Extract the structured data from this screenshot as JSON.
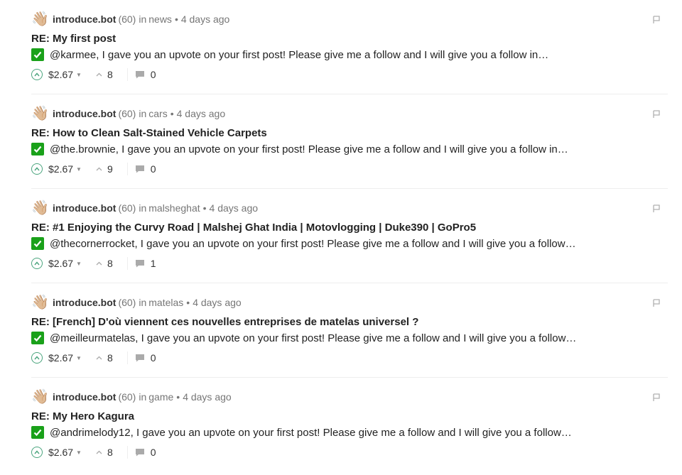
{
  "colors": {
    "upvote_accent": "#4ba57e",
    "check_green": "#1aa11a"
  },
  "icons": {
    "avatar": "waving-hand-icon",
    "flag": "flag-icon",
    "check": "check-icon",
    "upvote": "upvote-icon",
    "dropdown": "caret-down-icon",
    "votes": "chevron-up-icon",
    "comments": "comment-icon"
  },
  "posts": [
    {
      "author": "introduce.bot",
      "reputation": "(60)",
      "in_label": "in",
      "community": "news",
      "time": "4 days ago",
      "title": "RE: My first post",
      "body": "@karmee, I gave you an upvote on your first post! Please give me a follow and I will give you a follow in…",
      "payout": "$2.67",
      "votes": "8",
      "comments": "0"
    },
    {
      "author": "introduce.bot",
      "reputation": "(60)",
      "in_label": "in",
      "community": "cars",
      "time": "4 days ago",
      "title": "RE: How to Clean Salt-Stained Vehicle Carpets",
      "body": "@the.brownie, I gave you an upvote on your first post! Please give me a follow and I will give you a follow in…",
      "payout": "$2.67",
      "votes": "9",
      "comments": "0"
    },
    {
      "author": "introduce.bot",
      "reputation": "(60)",
      "in_label": "in",
      "community": "malsheghat",
      "time": "4 days ago",
      "title": "RE: #1 Enjoying the Curvy Road | Malshej Ghat India | Motovlogging | Duke390 | GoPro5",
      "body": "@thecornerrocket, I gave you an upvote on your first post! Please give me a follow and I will give you a follow…",
      "payout": "$2.67",
      "votes": "8",
      "comments": "1"
    },
    {
      "author": "introduce.bot",
      "reputation": "(60)",
      "in_label": "in",
      "community": "matelas",
      "time": "4 days ago",
      "title": "RE: [French] D'où viennent ces nouvelles entreprises de matelas universel ?",
      "body": "@meilleurmatelas, I gave you an upvote on your first post! Please give me a follow and I will give you a follow…",
      "payout": "$2.67",
      "votes": "8",
      "comments": "0"
    },
    {
      "author": "introduce.bot",
      "reputation": "(60)",
      "in_label": "in",
      "community": "game",
      "time": "4 days ago",
      "title": "RE: My Hero Kagura",
      "body": "@andrimelody12, I gave you an upvote on your first post! Please give me a follow and I will give you a follow…",
      "payout": "$2.67",
      "votes": "8",
      "comments": "0"
    }
  ]
}
